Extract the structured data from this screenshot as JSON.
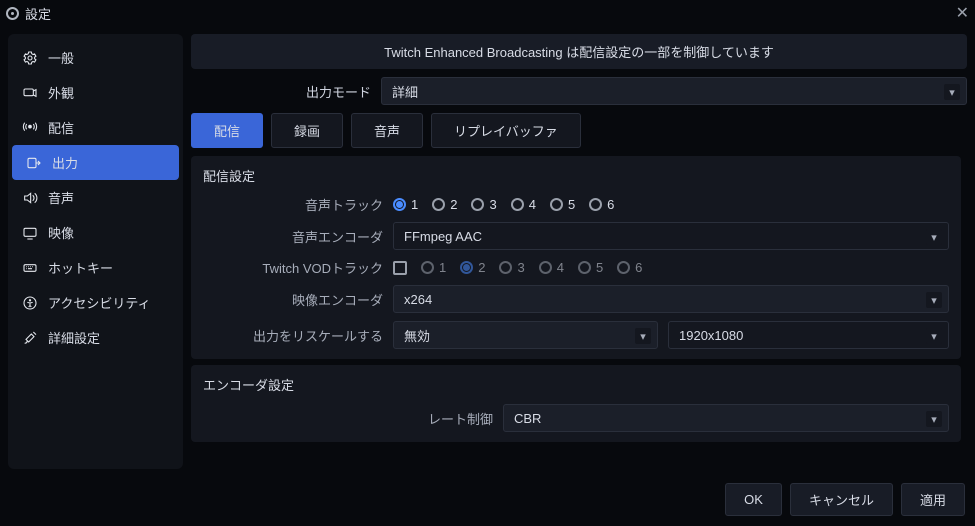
{
  "title": "設定",
  "banner": "Twitch Enhanced Broadcasting は配信設定の一部を制御しています",
  "sidebar": {
    "items": [
      {
        "label": "一般"
      },
      {
        "label": "外観"
      },
      {
        "label": "配信"
      },
      {
        "label": "出力"
      },
      {
        "label": "音声"
      },
      {
        "label": "映像"
      },
      {
        "label": "ホットキー"
      },
      {
        "label": "アクセシビリティ"
      },
      {
        "label": "詳細設定"
      }
    ]
  },
  "outputMode": {
    "label": "出力モード",
    "value": "詳細"
  },
  "tabs": [
    {
      "label": "配信"
    },
    {
      "label": "録画"
    },
    {
      "label": "音声"
    },
    {
      "label": "リプレイバッファ"
    }
  ],
  "streamSettings": {
    "title": "配信設定",
    "audioTrack": {
      "label": "音声トラック",
      "options": [
        "1",
        "2",
        "3",
        "4",
        "5",
        "6"
      ],
      "selected": "1"
    },
    "audioEncoder": {
      "label": "音声エンコーダ",
      "value": "FFmpeg AAC"
    },
    "vodTrack": {
      "label": "Twitch VODトラック",
      "enabled": false,
      "options": [
        "1",
        "2",
        "3",
        "4",
        "5",
        "6"
      ],
      "selected": "2"
    },
    "videoEncoder": {
      "label": "映像エンコーダ",
      "value": "x264"
    },
    "rescale": {
      "label": "出力をリスケールする",
      "value": "無効",
      "resolution": "1920x1080"
    }
  },
  "encoderSettings": {
    "title": "エンコーダ設定",
    "rateControl": {
      "label": "レート制御",
      "value": "CBR"
    }
  },
  "buttons": {
    "ok": "OK",
    "cancel": "キャンセル",
    "apply": "適用"
  }
}
